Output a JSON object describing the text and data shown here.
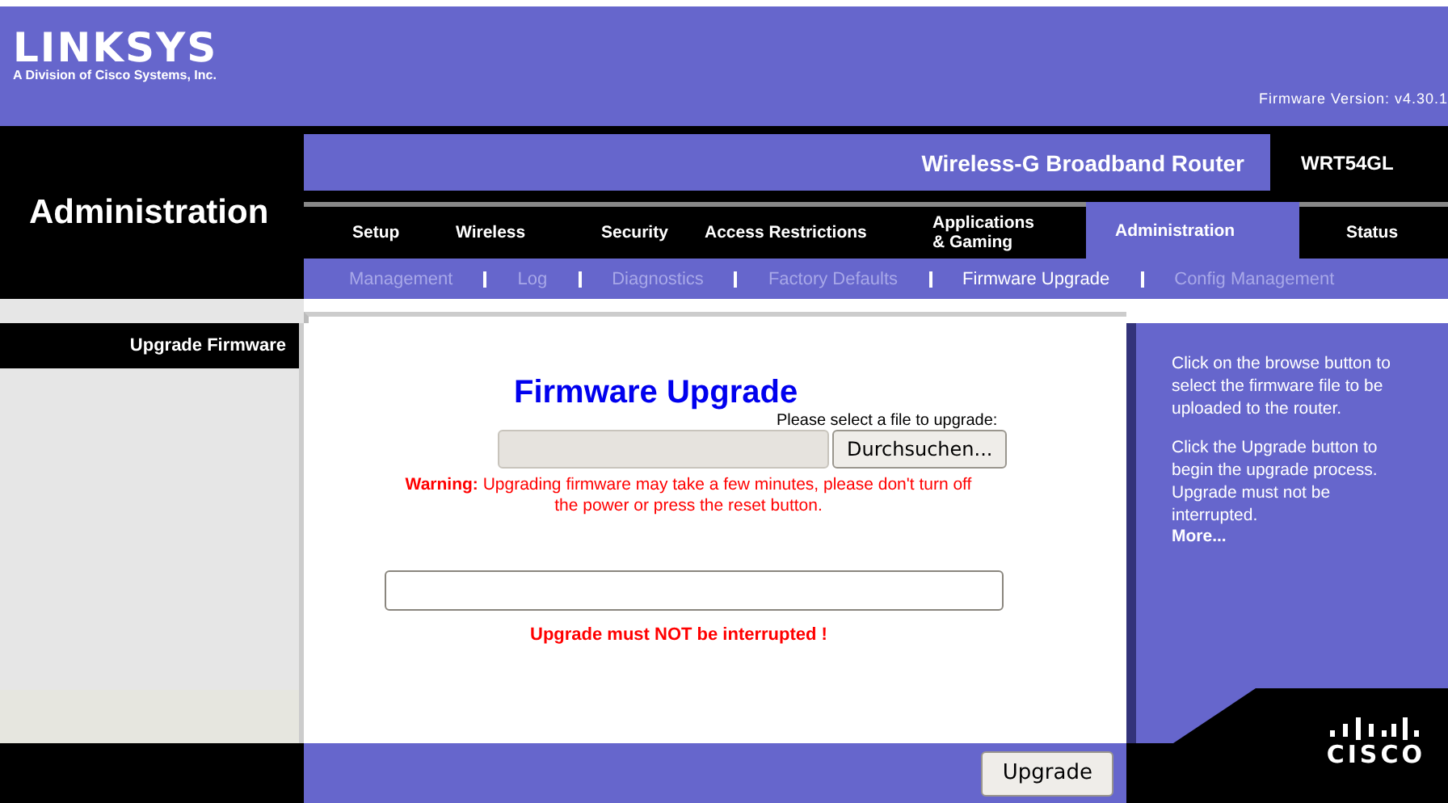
{
  "header": {
    "logo": "LINKSYS",
    "logo_subtitle": "A Division of Cisco Systems, Inc.",
    "firmware_version": "Firmware Version: v4.30.1"
  },
  "section_title": "Administration",
  "product": {
    "name": "Wireless-G Broadband Router",
    "model": "WRT54GL"
  },
  "tabs": [
    {
      "label": "Setup",
      "selected": false
    },
    {
      "label": "Wireless",
      "selected": false
    },
    {
      "label": "Security",
      "selected": false
    },
    {
      "label": "Access Restrictions",
      "selected": false
    },
    {
      "label": "Applications & Gaming",
      "selected": false
    },
    {
      "label": "Administration",
      "selected": true
    },
    {
      "label": "Status",
      "selected": false
    }
  ],
  "subtabs": [
    {
      "label": "Management",
      "selected": false
    },
    {
      "label": "Log",
      "selected": false
    },
    {
      "label": "Diagnostics",
      "selected": false
    },
    {
      "label": "Factory Defaults",
      "selected": false
    },
    {
      "label": "Firmware Upgrade",
      "selected": true
    },
    {
      "label": "Config Management",
      "selected": false
    }
  ],
  "sidebar": {
    "heading": "Upgrade Firmware"
  },
  "content": {
    "title": "Firmware Upgrade",
    "file_prompt": "Please select a file to upgrade:",
    "browse_button": "Durchsuchen...",
    "warning": "**Warning:** Upgrading firmware may take a few minutes, please don't turn off the power or press the reset button.",
    "notice": "Upgrade must NOT be interrupted !"
  },
  "help": {
    "paragraphs": [
      "Click on the browse button to select the firmware file to be uploaded to the router.",
      "Click the Upgrade button to begin the upgrade process. Upgrade must not be interrupted."
    ],
    "more_link": "More..."
  },
  "footer": {
    "upgrade_button": "Upgrade",
    "brand": "CISCO"
  }
}
